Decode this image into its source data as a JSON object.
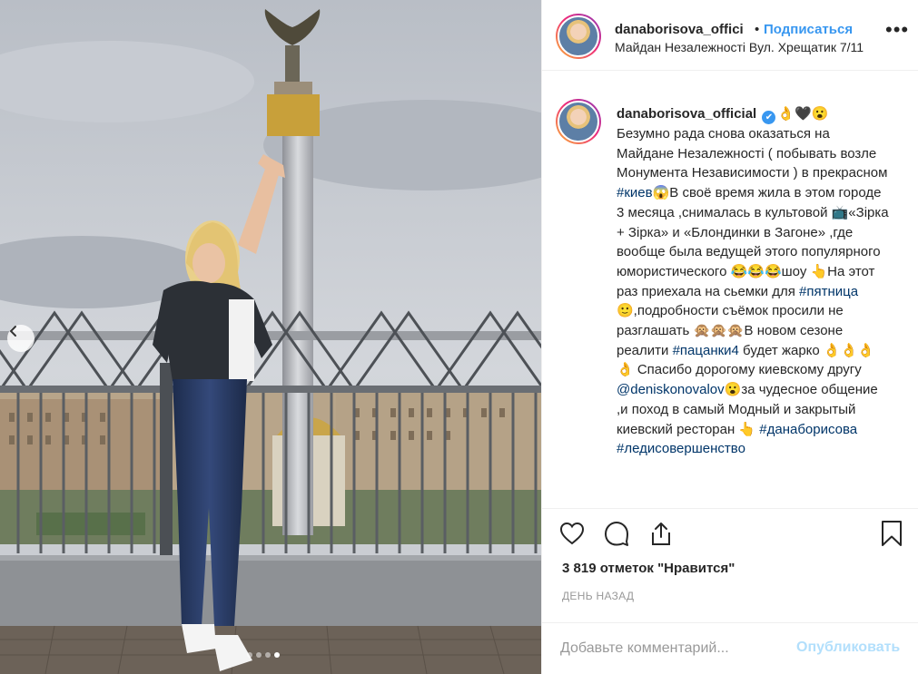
{
  "header": {
    "username": "danaborisova_offici",
    "bullet": "•",
    "follow_label": "Подписаться",
    "location": "Майдан Незалежності Вул. Хрещатик 7/11",
    "more_icon": "•••"
  },
  "caption": {
    "username": "danaborisova_official",
    "verified_mark": "✔",
    "emoji_after_name": "👌🖤😮",
    "p1": "Безумно рада снова оказаться на Майдане Незалежності ( побывать возле Монумента Независимости ) в прекрасном ",
    "tag_kiev": "#киев",
    "p2": "😱В своё время жила в этом городе 3 месяца ,снималась в культовой 📺«Зірка + Зірка» и «Блондинки в Загоне» ,где вообще была ведущей этого популярного юмористического 😂😂😂шоу 👆На этот раз приехала на сьемки для ",
    "tag_friday": "#пятница",
    "p3": "🙂,подробности съёмок просили не разглашать 🙊🙊🙊В новом сезоне реалити ",
    "tag_patsanki": "#пацанки4",
    "p4": " будет жарко 👌👌👌👌 Спасибо дорогому киевскому другу ",
    "mention": "@deniskonovalov",
    "p5": "😮за чудесное общение ,и поход в самый Модный и закрытый киевский ресторан 👆 ",
    "tag_dana": "#данаборисова",
    "space": " ",
    "tag_lady": "#ледисовершенство"
  },
  "photo": {
    "slides_total": 4,
    "active_slide": 4
  },
  "actions": {
    "like_icon": "heart-icon",
    "comment_icon": "comment-icon",
    "share_icon": "share-icon",
    "save_icon": "bookmark-icon"
  },
  "likes_text": "3 819 отметок \"Нравится\"",
  "time_text": "ДЕНЬ НАЗАД",
  "comment": {
    "placeholder": "Добавьте комментарий...",
    "publish_label": "Опубликовать"
  },
  "colors": {
    "link": "#003569",
    "accent": "#3897f0",
    "publish_disabled": "#b2dffc"
  }
}
